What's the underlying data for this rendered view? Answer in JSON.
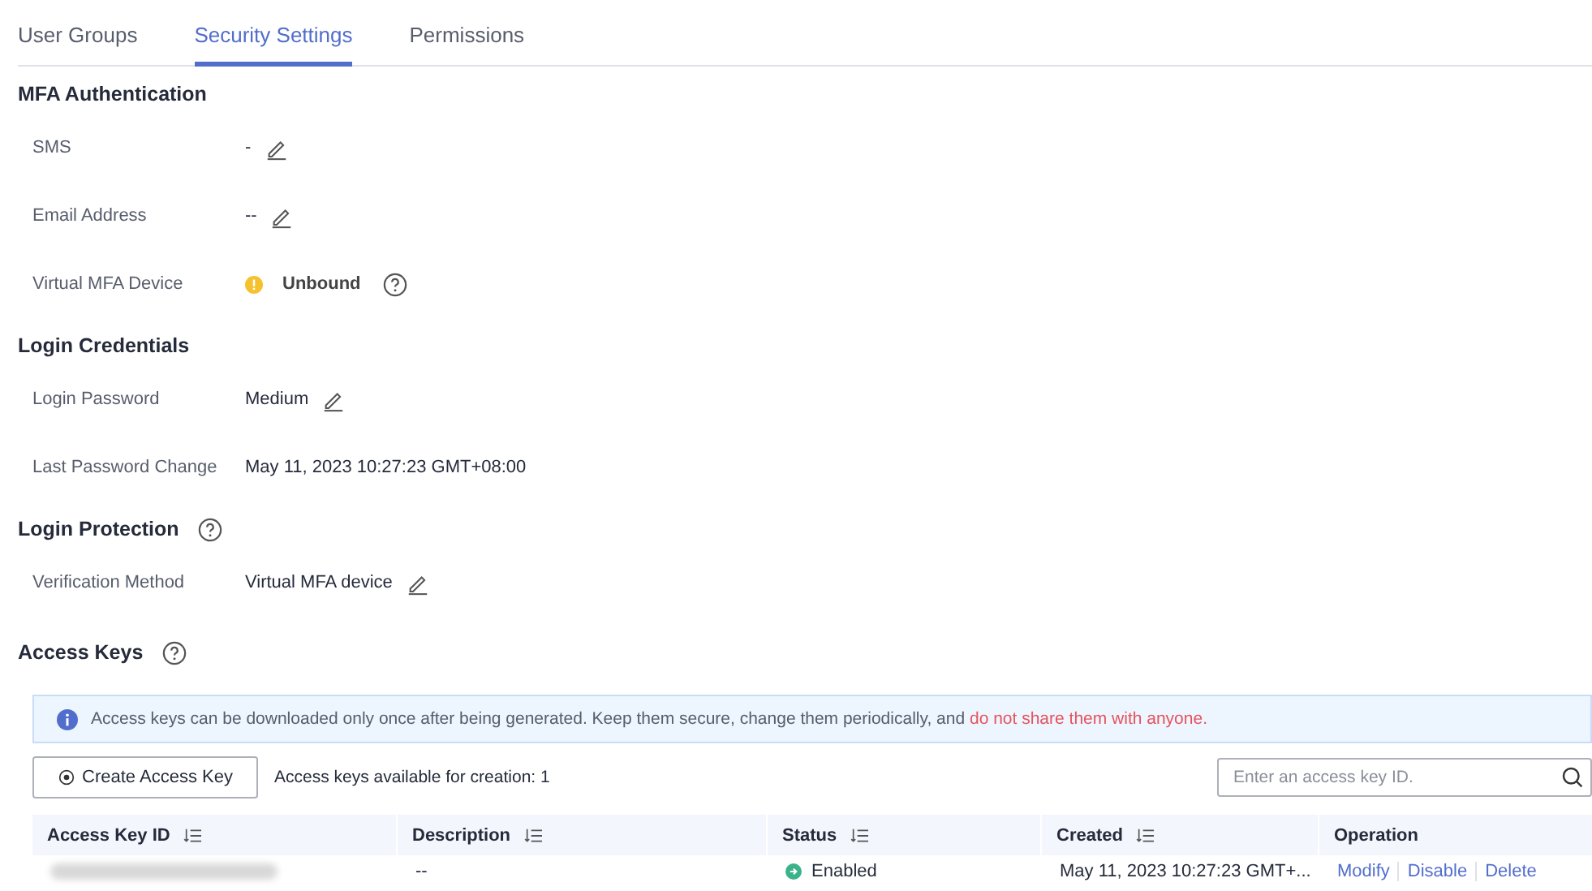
{
  "tabs": [
    {
      "label": "User Groups",
      "selected": false
    },
    {
      "label": "Security Settings",
      "selected": true
    },
    {
      "label": "Permissions",
      "selected": false
    }
  ],
  "sections": [
    {
      "title": "MFA Authentication",
      "help": false,
      "rows": [
        {
          "label": "SMS",
          "value": "-",
          "editable": true,
          "warning": false,
          "help": false
        },
        {
          "label": "Email Address",
          "value": "--",
          "editable": true,
          "warning": false,
          "help": false
        },
        {
          "label": "Virtual MFA Device",
          "value": "Unbound",
          "editable": false,
          "warning": true,
          "help": true
        }
      ]
    },
    {
      "title": "Login Credentials",
      "help": false,
      "rows": [
        {
          "label": "Login Password",
          "value": "Medium",
          "editable": true,
          "warning": false,
          "help": false
        },
        {
          "label": "Last Password Change",
          "value": "May 11, 2023 10:27:23 GMT+08:00",
          "editable": false,
          "warning": false,
          "help": false
        }
      ]
    },
    {
      "title": "Login Protection",
      "help": true,
      "rows": [
        {
          "label": "Verification Method",
          "value": "Virtual MFA device",
          "editable": true,
          "warning": false,
          "help": false
        }
      ]
    }
  ],
  "access_keys": {
    "title": "Access Keys",
    "help": true,
    "notice": {
      "text": "Access keys can be downloaded only once after being generated. Keep them secure, change them periodically, and ",
      "warning": "do not share them with anyone."
    },
    "create_button": "Create Access Key",
    "quota": "Access keys available for creation: 1",
    "search": {
      "placeholder": "Enter an access key ID."
    },
    "table": {
      "columns": [
        {
          "label": "Access Key ID",
          "sortable": true
        },
        {
          "label": "Description",
          "sortable": true
        },
        {
          "label": "Status",
          "sortable": true
        },
        {
          "label": "Created",
          "sortable": true
        },
        {
          "label": "Operation",
          "sortable": false
        }
      ],
      "rows": [
        {
          "id_blurred": true,
          "description": "--",
          "status": "Enabled",
          "enabled": true,
          "created": "May 11, 2023 10:27:23 GMT+...",
          "operations": [
            "Modify",
            "Disable",
            "Delete"
          ]
        }
      ]
    }
  }
}
